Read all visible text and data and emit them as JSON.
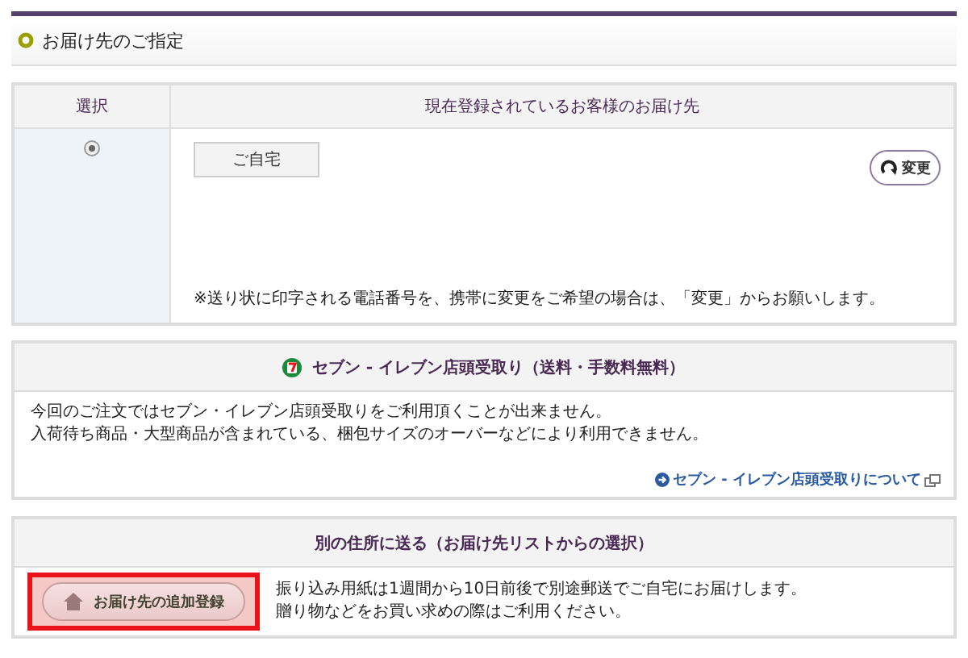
{
  "section_title": "お届け先のご指定",
  "address_table": {
    "columns": [
      "選択",
      "現在登録されているお客様のお届け先"
    ],
    "rows": [
      {
        "selected": true,
        "address_name": "ご自宅",
        "change_button": "変更",
        "note": "※送り状に印字される電話番号を、携帯に変更をご希望の場合は、「変更」からお願いします。"
      }
    ]
  },
  "seven_eleven": {
    "title": "セブン - イレブン店頭受取り（送料・手数料無料）",
    "lines": [
      "今回のご注文ではセブン・イレブン店頭受取りをご利用頂くことが出来ません。",
      "入荷待ち商品・大型商品が含まれている、梱包サイズのオーバーなどにより利用できません。"
    ],
    "link": "セブン - イレブン店頭受取りについて"
  },
  "other_address": {
    "title": "別の住所に送る（お届け先リストからの選択）",
    "button": {
      "label": "お届け先の追加登録",
      "highlighted": true
    },
    "lines": [
      "振り込み用紙は1週間から10日前後で別途郵送でご自宅にお届けします。",
      "贈り物などをお買い求めの際はご利用ください。"
    ]
  }
}
